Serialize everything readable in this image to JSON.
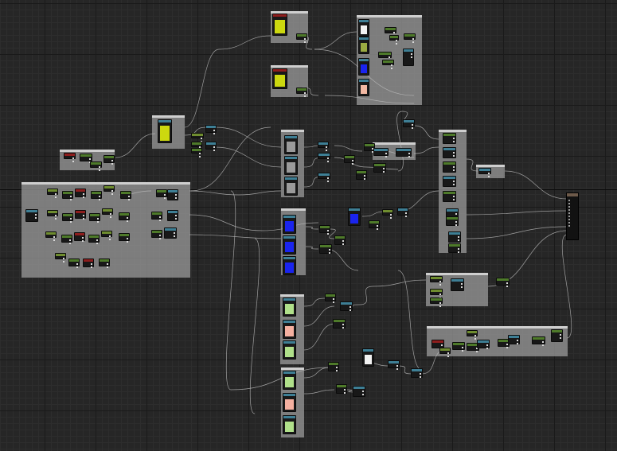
{
  "editor": {
    "type": "material-graph",
    "background": "#262626",
    "comment_color": "#969696",
    "node_body_color": "#181818",
    "header_colors": {
      "constant": "#6f8d2f",
      "texture_sample": "#3e7f95",
      "math": "#4e7a2a",
      "function": "#8e1d1d",
      "result": "#6d5a4a"
    },
    "swatch_colors": {
      "white": "#f2f2f2",
      "olive": "#9aab42",
      "blue": "#1a24ee",
      "peach": "#f2b8a2",
      "yellow": "#ccd80f",
      "gray": "#9a9a9a",
      "light_green": "#b0e08a",
      "salmon": "#f5b0a0"
    },
    "icons": [
      "wire-connector-icon",
      "pin-icon",
      "texture-preview-icon"
    ]
  }
}
